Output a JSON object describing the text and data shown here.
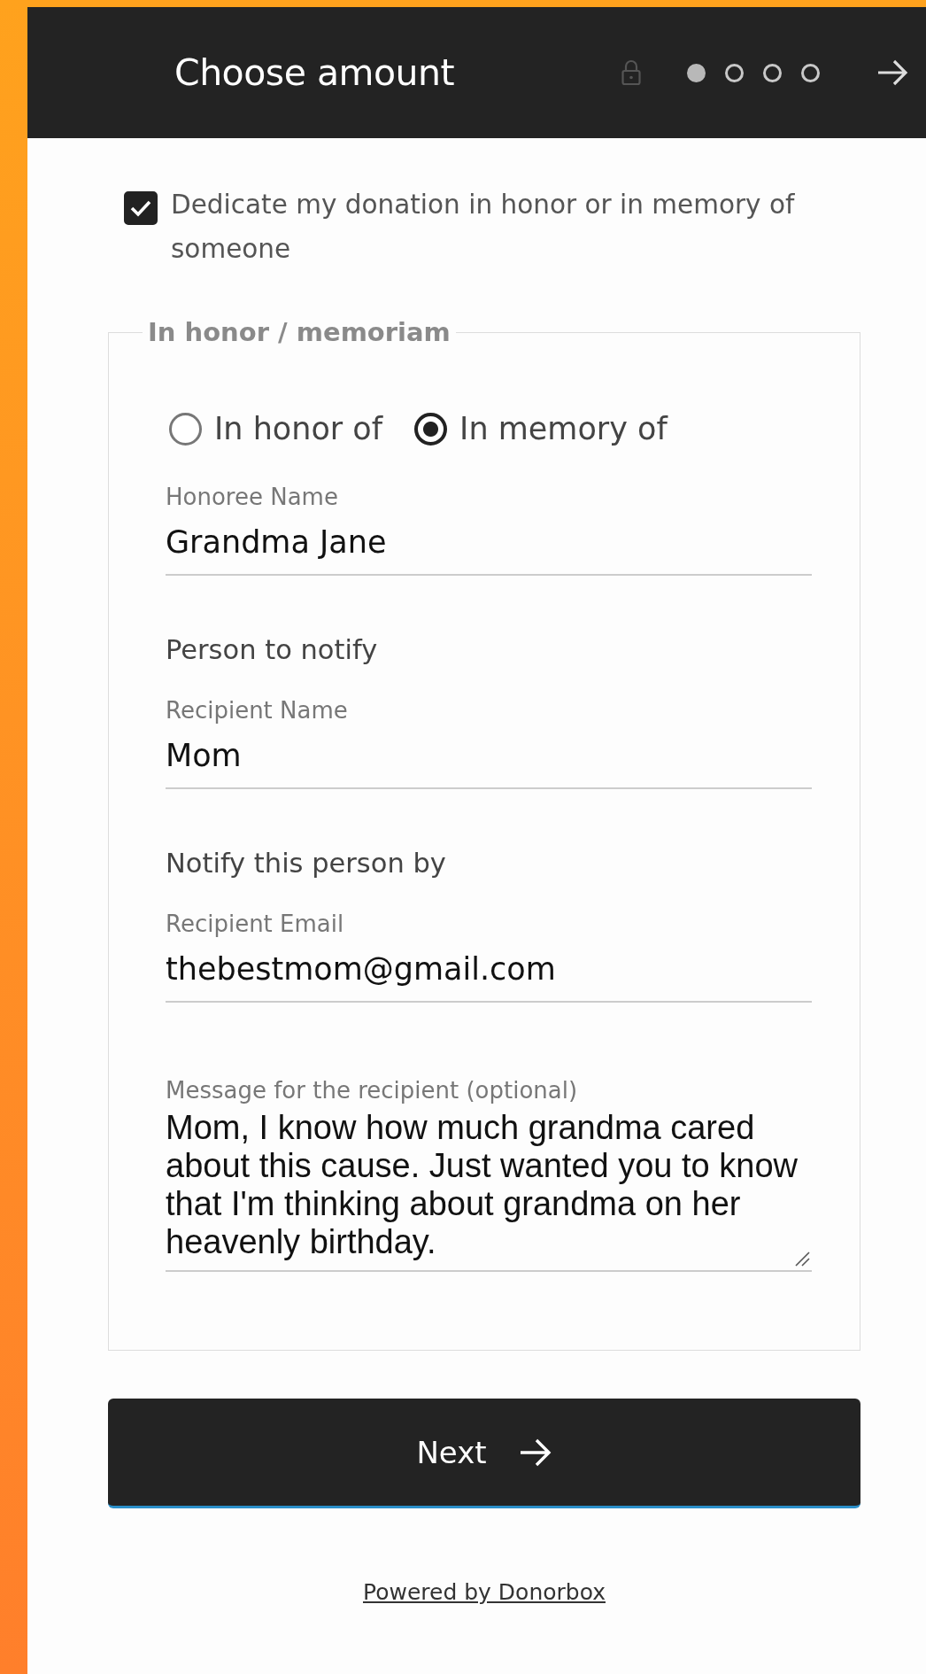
{
  "header": {
    "title": "Choose amount",
    "steps": [
      {
        "selected": true
      },
      {
        "selected": false
      },
      {
        "selected": false
      },
      {
        "selected": false
      }
    ]
  },
  "dedicate": {
    "label": "Dedicate my donation in honor or in memory of someone",
    "checked": true
  },
  "fieldset": {
    "legend": "In honor / memoriam",
    "options": [
      {
        "label": "In honor of",
        "selected": false
      },
      {
        "label": "In memory of",
        "selected": true
      }
    ],
    "items": [
      {
        "kind": "field",
        "label": "Honoree Name",
        "value": "Grandma Jane"
      },
      {
        "kind": "heading",
        "text": "Person to notify"
      },
      {
        "kind": "field",
        "label": "Recipient Name",
        "value": "Mom"
      },
      {
        "kind": "heading",
        "text": "Notify this person by"
      },
      {
        "kind": "field",
        "label": "Recipient Email",
        "value": "thebestmom@gmail.com"
      },
      {
        "kind": "textarea",
        "label": "Message for the recipient (optional)",
        "value": "Mom, I know how much grandma cared about this cause. Just wanted you to know that I'm thinking about grandma on her heavenly birthday."
      }
    ]
  },
  "next_button": "Next",
  "footer_link": "Powered by Donorbox"
}
